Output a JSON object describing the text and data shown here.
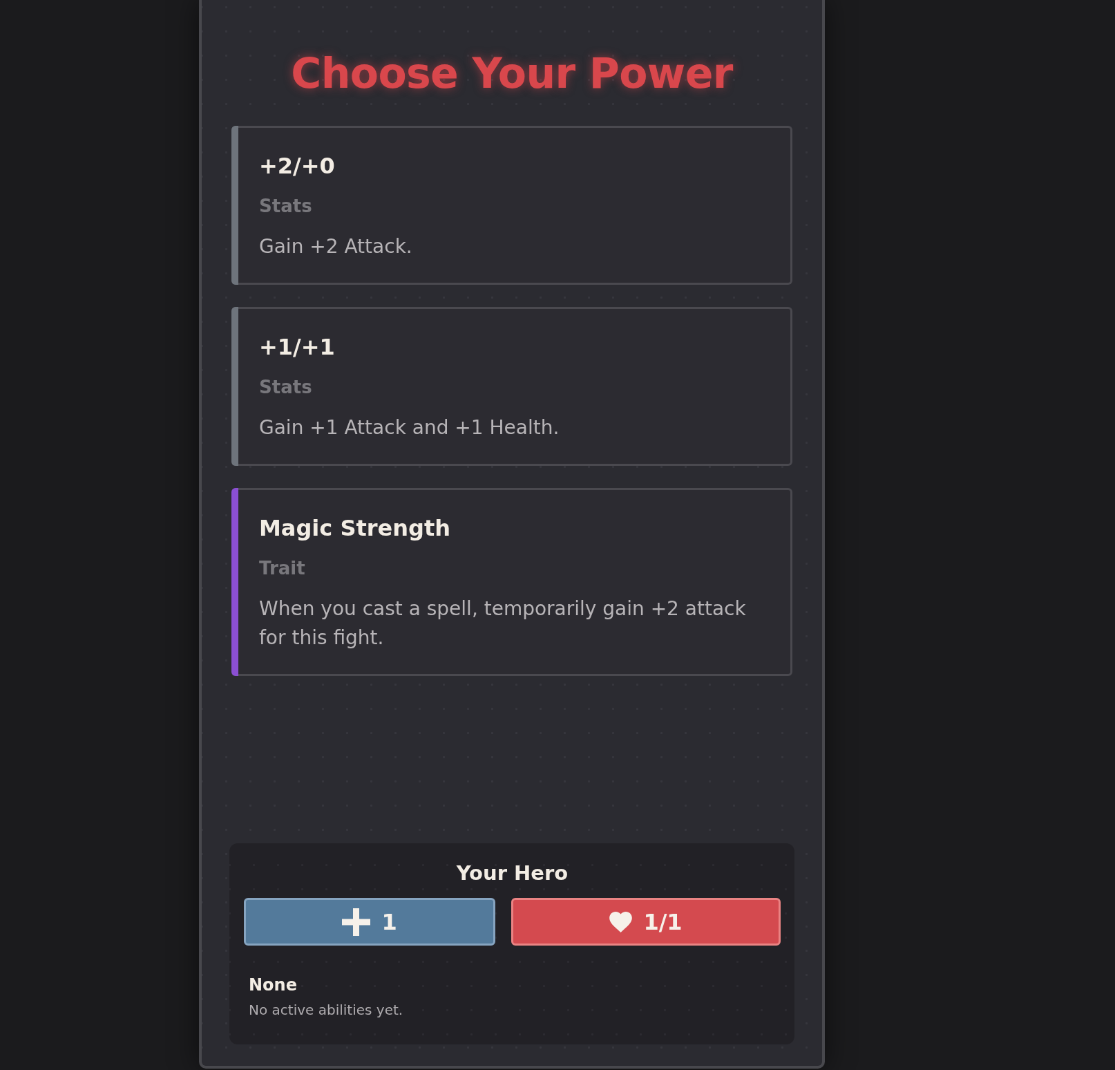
{
  "title": "Choose Your Power",
  "choices": [
    {
      "name": "+2/+0",
      "category": "Stats",
      "description": "Gain +2 Attack.",
      "color": "#6e747c"
    },
    {
      "name": "+1/+1",
      "category": "Stats",
      "description": "Gain +1 Attack and +1 Health.",
      "color": "#6e747c"
    },
    {
      "name": "Magic Strength",
      "category": "Trait",
      "description": "When you cast a spell, temporarily gain +2 attack for this fight.",
      "color": "#8b4fd3"
    }
  ],
  "hero": {
    "title": "Your Hero",
    "stats": [
      {
        "kind": "attack",
        "value": "1"
      },
      {
        "kind": "health",
        "value": "1/1"
      }
    ],
    "ability": {
      "name": "None",
      "description": "No active abilities yet."
    }
  }
}
